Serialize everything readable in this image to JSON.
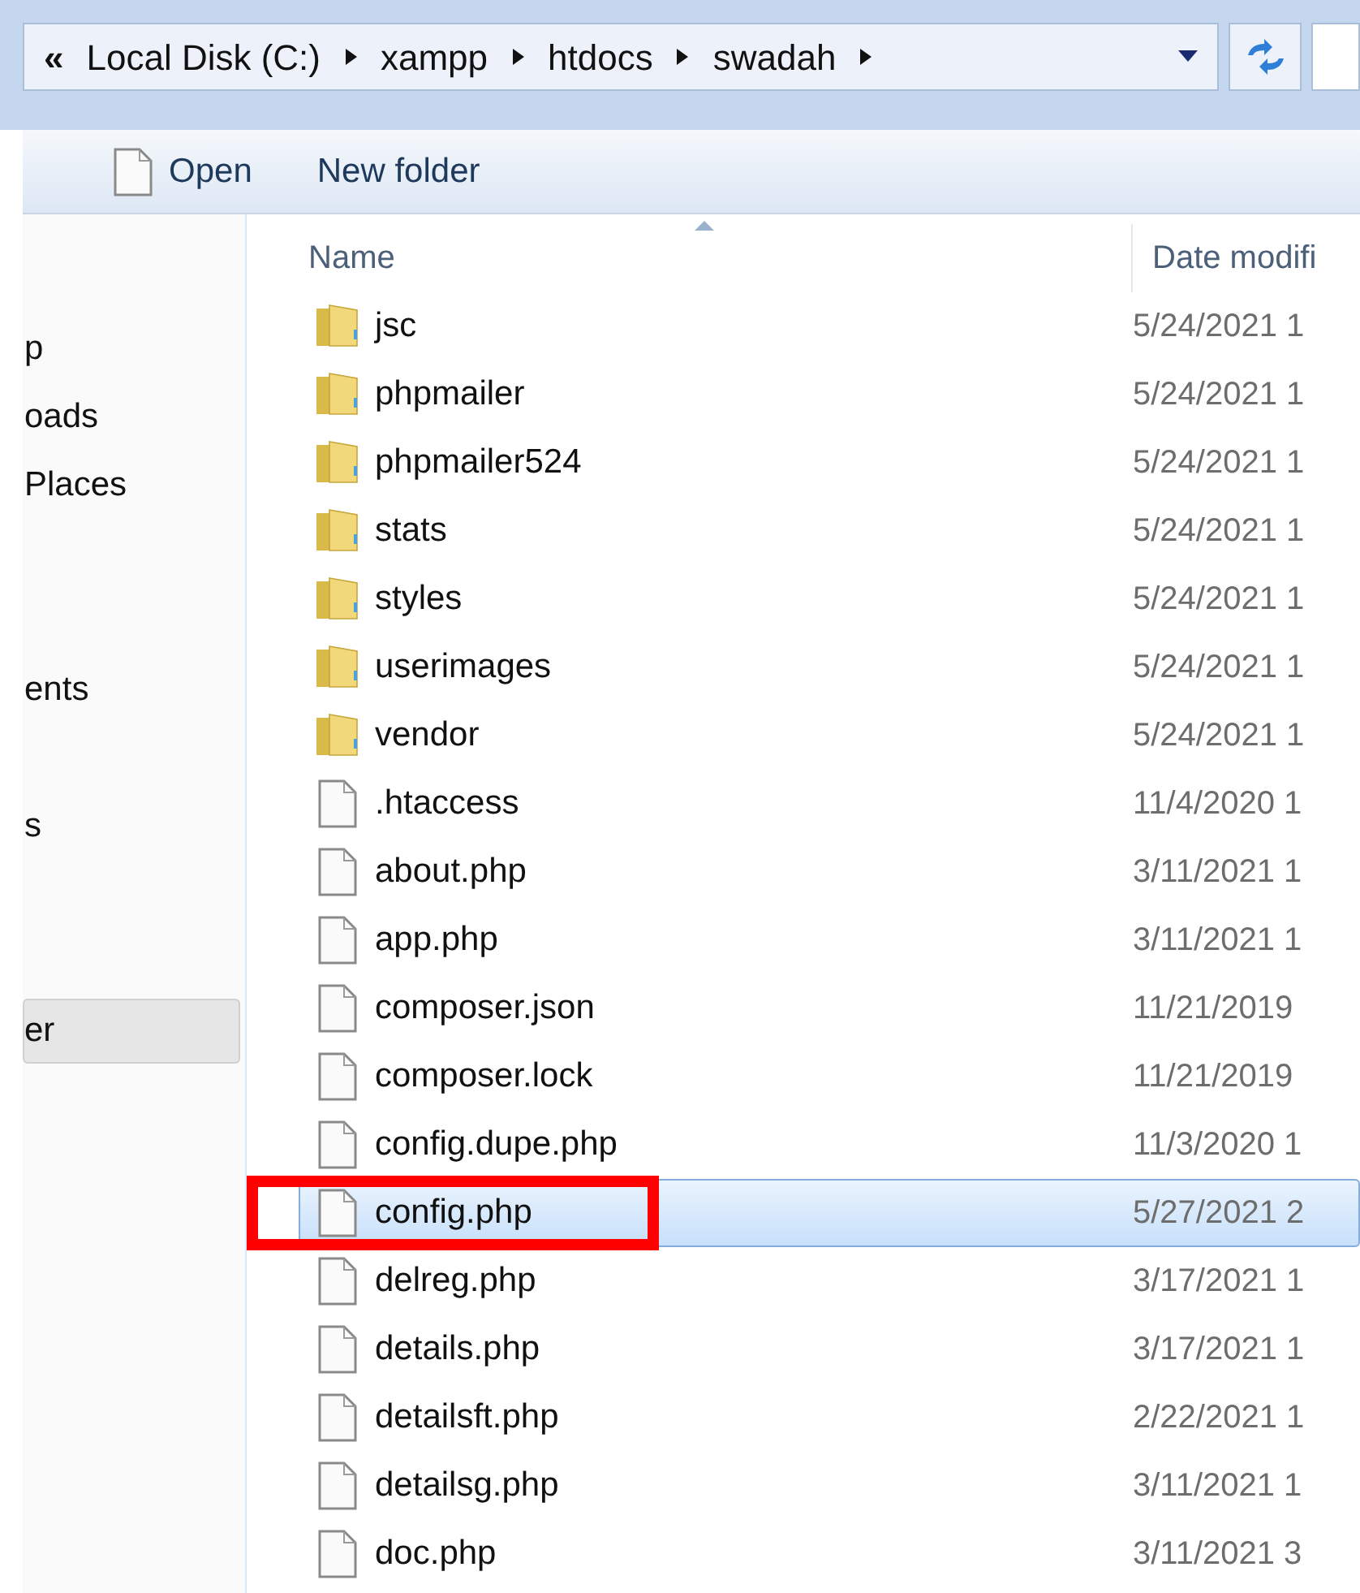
{
  "address_bar": {
    "overflow": "«",
    "crumbs": [
      "Local Disk (C:)",
      "xampp",
      "htdocs",
      "swadah"
    ]
  },
  "toolbar": {
    "buttons": [
      {
        "label": "Open",
        "kind": "file"
      },
      {
        "label": "New folder",
        "kind": "plain"
      }
    ]
  },
  "sidebar": {
    "items": [
      {
        "kind": "link",
        "label": "p",
        "selected": false
      },
      {
        "kind": "link",
        "label": "oads",
        "selected": false
      },
      {
        "kind": "link",
        "label": "Places",
        "selected": false
      },
      {
        "kind": "gap"
      },
      {
        "kind": "gap"
      },
      {
        "kind": "link",
        "label": "ents",
        "selected": false
      },
      {
        "kind": "gap"
      },
      {
        "kind": "link",
        "label": "s",
        "selected": false
      },
      {
        "kind": "gap"
      },
      {
        "kind": "gap"
      },
      {
        "kind": "link",
        "label": "er",
        "selected": true
      }
    ]
  },
  "table": {
    "columns": [
      "Name",
      "Date modifi"
    ],
    "rows": [
      {
        "name": "jsc",
        "kind": "folder",
        "date": "5/24/2021 1",
        "selected": false
      },
      {
        "name": "phpmailer",
        "kind": "folder",
        "date": "5/24/2021 1",
        "selected": false
      },
      {
        "name": "phpmailer524",
        "kind": "folder",
        "date": "5/24/2021 1",
        "selected": false
      },
      {
        "name": "stats",
        "kind": "folder",
        "date": "5/24/2021 1",
        "selected": false
      },
      {
        "name": "styles",
        "kind": "folder",
        "date": "5/24/2021 1",
        "selected": false
      },
      {
        "name": "userimages",
        "kind": "folder",
        "date": "5/24/2021 1",
        "selected": false
      },
      {
        "name": "vendor",
        "kind": "folder",
        "date": "5/24/2021 1",
        "selected": false
      },
      {
        "name": ".htaccess",
        "kind": "file",
        "date": "11/4/2020 1",
        "selected": false
      },
      {
        "name": "about.php",
        "kind": "file",
        "date": "3/11/2021 1",
        "selected": false
      },
      {
        "name": "app.php",
        "kind": "file",
        "date": "3/11/2021 1",
        "selected": false
      },
      {
        "name": "composer.json",
        "kind": "file",
        "date": "11/21/2019",
        "selected": false
      },
      {
        "name": "composer.lock",
        "kind": "file",
        "date": "11/21/2019",
        "selected": false
      },
      {
        "name": "config.dupe.php",
        "kind": "file",
        "date": "11/3/2020 1",
        "selected": false
      },
      {
        "name": "config.php",
        "kind": "file",
        "date": "5/27/2021 2",
        "selected": true,
        "highlighted": true
      },
      {
        "name": "delreg.php",
        "kind": "file",
        "date": "3/17/2021 1",
        "selected": false
      },
      {
        "name": "details.php",
        "kind": "file",
        "date": "3/17/2021 1",
        "selected": false
      },
      {
        "name": "detailsft.php",
        "kind": "file",
        "date": "2/22/2021 1",
        "selected": false
      },
      {
        "name": "detailsg.php",
        "kind": "file",
        "date": "3/11/2021 1",
        "selected": false
      },
      {
        "name": "doc.php",
        "kind": "file",
        "date": "3/11/2021 3",
        "selected": false
      }
    ]
  }
}
